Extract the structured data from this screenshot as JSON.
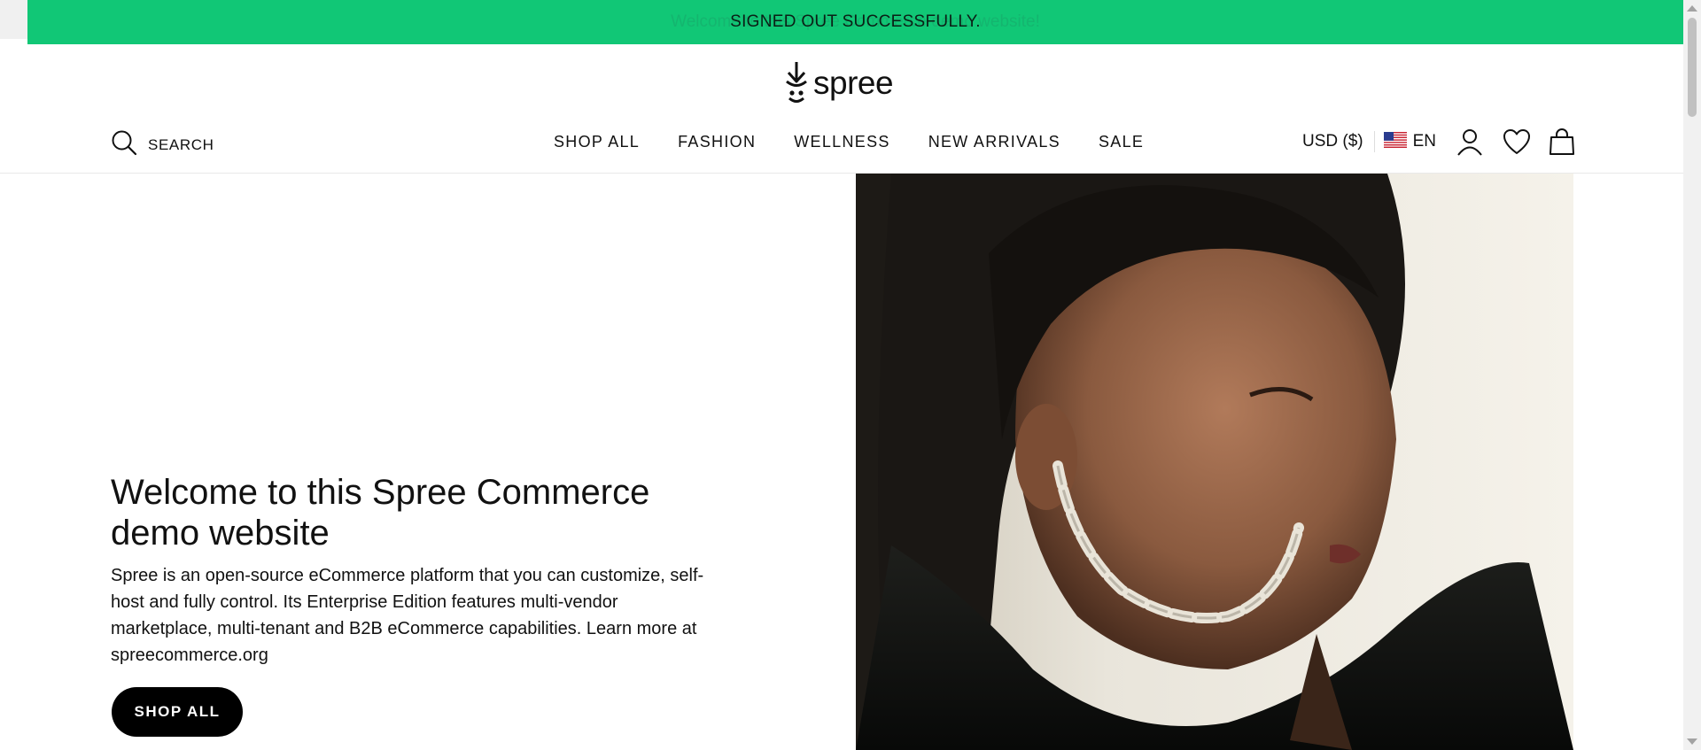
{
  "flash": {
    "message": "SIGNED OUT SUCCESSFULLY.",
    "ghost_text": "Welcome to this Spree Commerce demo website!"
  },
  "logo": {
    "text": "spree"
  },
  "header": {
    "search_label": "SEARCH",
    "nav": [
      "SHOP ALL",
      "FASHION",
      "WELLNESS",
      "NEW ARRIVALS",
      "SALE"
    ],
    "currency": "USD ($)",
    "language": "EN"
  },
  "hero": {
    "title": "Welcome to this Spree Commerce demo website",
    "text": "Spree is an open-source eCommerce platform that you can customize, self-host and fully control. Its Enterprise Edition features multi-vendor marketplace, multi-tenant and B2B eCommerce capabilities. Learn more at spreecommerce.org",
    "cta": "SHOP ALL"
  },
  "colors": {
    "banner": "#11c776",
    "text": "#111111",
    "button": "#000000"
  },
  "icons": [
    "logo-mark-icon",
    "search-icon",
    "us-flag-icon",
    "account-icon",
    "wishlist-heart-icon",
    "cart-bag-icon"
  ]
}
